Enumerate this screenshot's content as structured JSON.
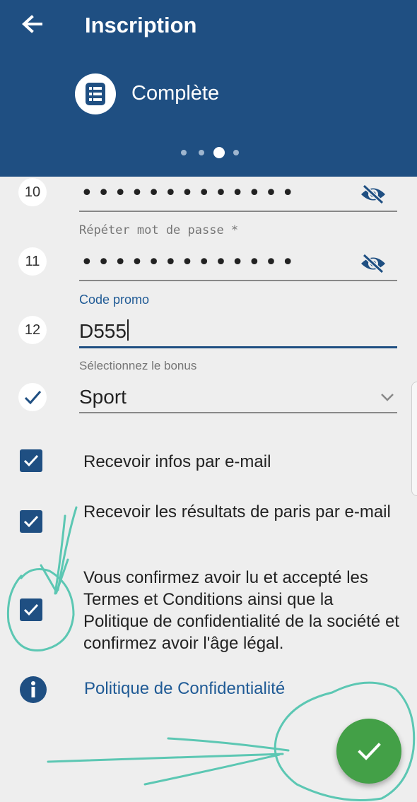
{
  "header": {
    "title": "Inscription",
    "step_label": "Complète",
    "page_indicator": {
      "total": 4,
      "active": 3
    },
    "background_color": "#1f4f82",
    "back_icon": "arrow-left-icon",
    "step_icon": "form-list-icon"
  },
  "form": {
    "password": {
      "number": "10",
      "value_masked": "•••••••••••••",
      "toggle_icon": "eye-off-icon"
    },
    "repeat_password": {
      "number": "11",
      "label": "Répéter mot de passe *",
      "value_masked": "•••••••••••••",
      "toggle_icon": "eye-off-icon"
    },
    "promo": {
      "number": "12",
      "label": "Code promo",
      "value": "D555"
    },
    "bonus": {
      "label": "Sélectionnez le bonus",
      "value": "Sport",
      "status_icon": "check-icon",
      "dropdown_icon": "chevron-down-icon"
    }
  },
  "checkboxes": [
    {
      "label": "Recevoir infos par e-mail",
      "checked": true
    },
    {
      "label": "Recevoir les résultats de paris par e-mail",
      "checked": true
    },
    {
      "label": "Vous confirmez avoir lu et accepté les Termes et Conditions ainsi que la Politique de confidentialité de la société et confirmez avoir l'âge légal.",
      "checked": true
    }
  ],
  "policy": {
    "label": "Politique de Confidentialité",
    "icon": "info-icon"
  },
  "submit": {
    "icon": "check-icon",
    "color": "#43a047"
  },
  "annotation_color": "#5cc7b3"
}
